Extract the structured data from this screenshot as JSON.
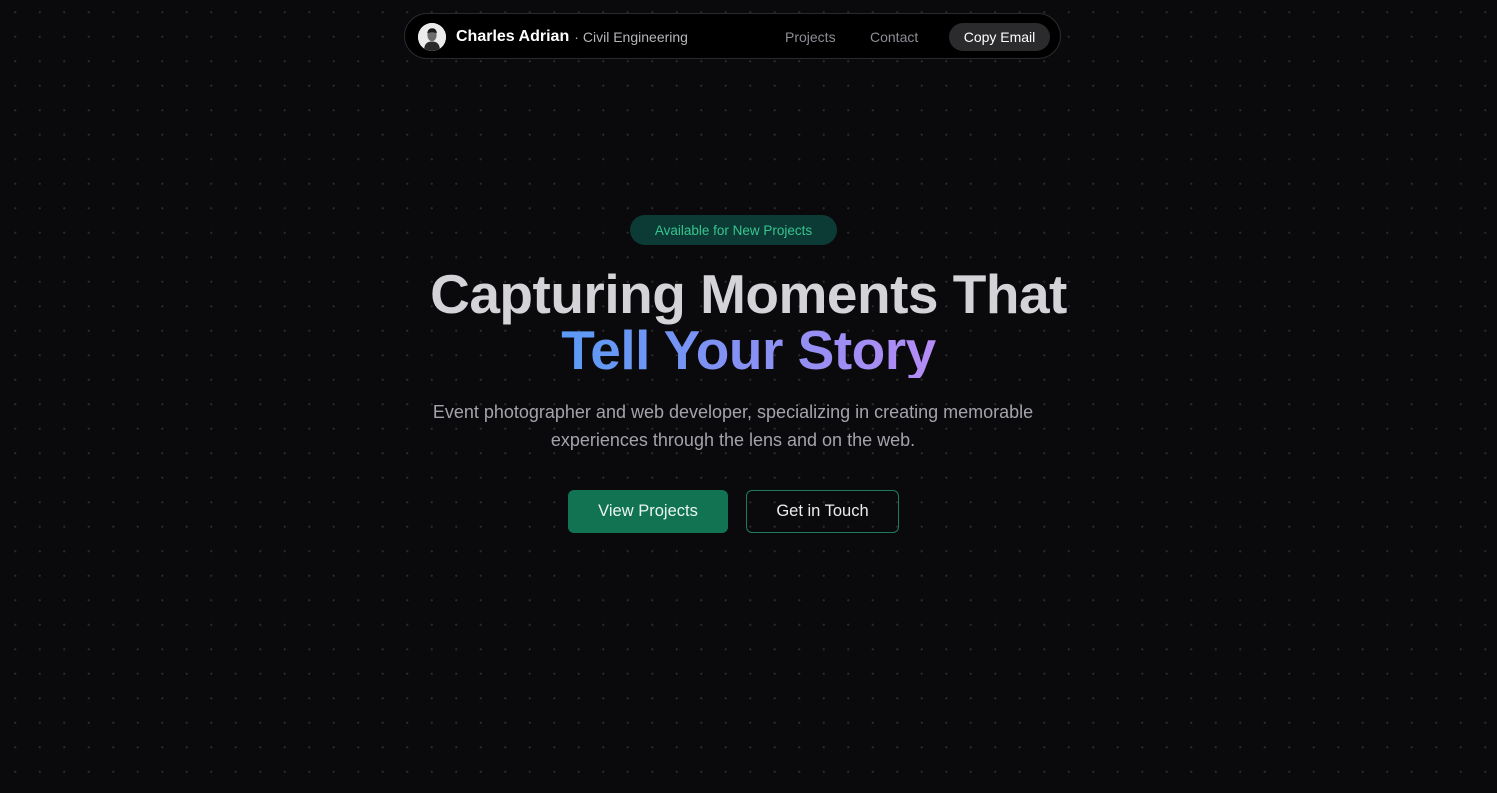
{
  "nav": {
    "avatar_icon": "portrait-avatar",
    "name": "Charles Adrian",
    "separator": "·",
    "role": "Civil Engineering",
    "links": [
      "Projects",
      "Contact"
    ],
    "copy_email_label": "Copy Email"
  },
  "hero": {
    "badge": "Available for New Projects",
    "headline_line1": "Capturing Moments That",
    "headline_line2": "Tell Your Story",
    "subtitle": "Event photographer and web developer, specializing in creating memorable experiences through the lens and on the web.",
    "primary_button": "View Projects",
    "secondary_button": "Get in Touch"
  },
  "colors": {
    "background": "#0a0a0c",
    "accent_green": "#117352",
    "badge_text": "#36c58f",
    "gradient_start": "#5a9af5",
    "gradient_end": "#b58cf5"
  }
}
